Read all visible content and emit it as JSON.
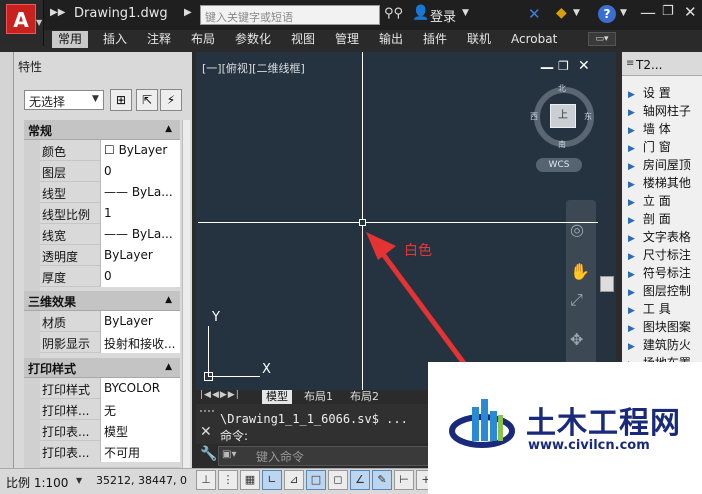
{
  "titlebar": {
    "document_title": "Drawing1.dwg",
    "search_placeholder": "键入关键字或短语",
    "login_label": "登录"
  },
  "ribbon": {
    "tabs": [
      "常用",
      "插入",
      "注释",
      "布局",
      "参数化",
      "视图",
      "管理",
      "输出",
      "插件",
      "联机",
      "Acrobat"
    ],
    "active_tab": "常用"
  },
  "properties": {
    "title": "特性",
    "selection": "无选择",
    "sections": [
      {
        "name": "常规",
        "rows": [
          {
            "key": "颜色",
            "value": "ByLayer"
          },
          {
            "key": "图层",
            "value": "0"
          },
          {
            "key": "线型",
            "value": "—— ByLa..."
          },
          {
            "key": "线型比例",
            "value": "1"
          },
          {
            "key": "线宽",
            "value": "—— ByLa..."
          },
          {
            "key": "透明度",
            "value": "ByLayer"
          },
          {
            "key": "厚度",
            "value": "0"
          }
        ]
      },
      {
        "name": "三维效果",
        "rows": [
          {
            "key": "材质",
            "value": "ByLayer"
          },
          {
            "key": "阴影显示",
            "value": "投射和接收..."
          }
        ]
      },
      {
        "name": "打印样式",
        "rows": [
          {
            "key": "打印样式",
            "value": "BYCOLOR"
          },
          {
            "key": "打印样...",
            "value": "无"
          },
          {
            "key": "打印表...",
            "value": "模型"
          },
          {
            "key": "打印表...",
            "value": "不可用"
          }
        ]
      }
    ]
  },
  "viewport": {
    "label": "[一][俯视][二维线框]",
    "compass": {
      "north": "北",
      "south": "南",
      "east": "东",
      "west": "西",
      "top": "上"
    },
    "wcs_label": "WCS",
    "ucs_x": "X",
    "ucs_y": "Y",
    "annotation": "白色",
    "crosshair_color": "#ffffff"
  },
  "layout_tabs": [
    "模型",
    "布局1",
    "布局2"
  ],
  "command": {
    "history": "\\Drawing1_1_1_6066.sv$ ...",
    "prompt": "命令:",
    "input_placeholder": "键入命令"
  },
  "statusbar": {
    "scale": "比例 1:100",
    "coords": "35212, 38447, 0"
  },
  "tool_palette": {
    "title": "T2...",
    "items": [
      "设 置",
      "轴网柱子",
      "墙 体",
      "门 窗",
      "房间屋顶",
      "楼梯其他",
      "立 面",
      "剖 面",
      "文字表格",
      "尺寸标注",
      "符号标注",
      "图层控制",
      "工 具",
      "图块图案",
      "建筑防火",
      "场地布置"
    ]
  },
  "watermark": {
    "title": "土木工程网",
    "url": "www.civilcn.com"
  },
  "colors": {
    "canvas": "#253341",
    "accent_red": "#e33333",
    "ribbon_active": "#c9c9c9"
  }
}
